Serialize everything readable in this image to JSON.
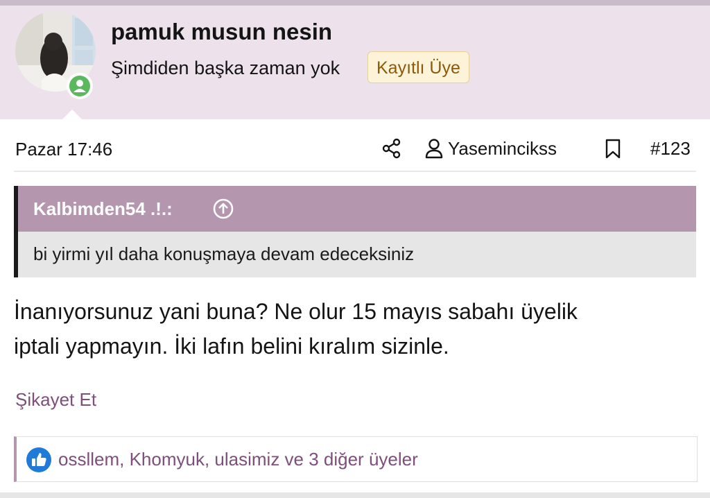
{
  "author": {
    "username": "pamuk musun nesin",
    "custom_title": "Şimdiden başka zaman yok",
    "banner": "Kayıtlı Üye",
    "avatar_icon": "avatar-photo",
    "status_icon": "online-user-icon"
  },
  "post": {
    "date": "Pazar 17:46",
    "reporter": "Yasemincikss",
    "number": "#123",
    "share_icon": "share-icon",
    "reporter_icon": "user-icon",
    "bookmark_icon": "bookmark-icon"
  },
  "quote": {
    "author": "Kalbimden54 .!.:",
    "jump_icon": "arrow-up-circle-icon",
    "text": "bi yirmi yıl daha konuşmaya devam edeceksiniz"
  },
  "message": {
    "lines": [
      "İnanıyorsunuz yani buna? Ne olur 15 mayıs sabahı üyelik",
      "iptali yapmayın. İki lafın belini kıralım sizinle."
    ]
  },
  "actions": {
    "report": "Şikayet Et"
  },
  "reactions": {
    "icon": "like-icon",
    "text": "ossllem, Khomyuk, ulasimiz ve 3 diğer üyeler"
  },
  "colors": {
    "header_bg": "#ede2ec",
    "quote_head_bg": "#b496ae",
    "link": "#7d4f7a",
    "banner_bg": "#fdf3d8",
    "online": "#5cb85c",
    "like": "#1f7ad8"
  }
}
